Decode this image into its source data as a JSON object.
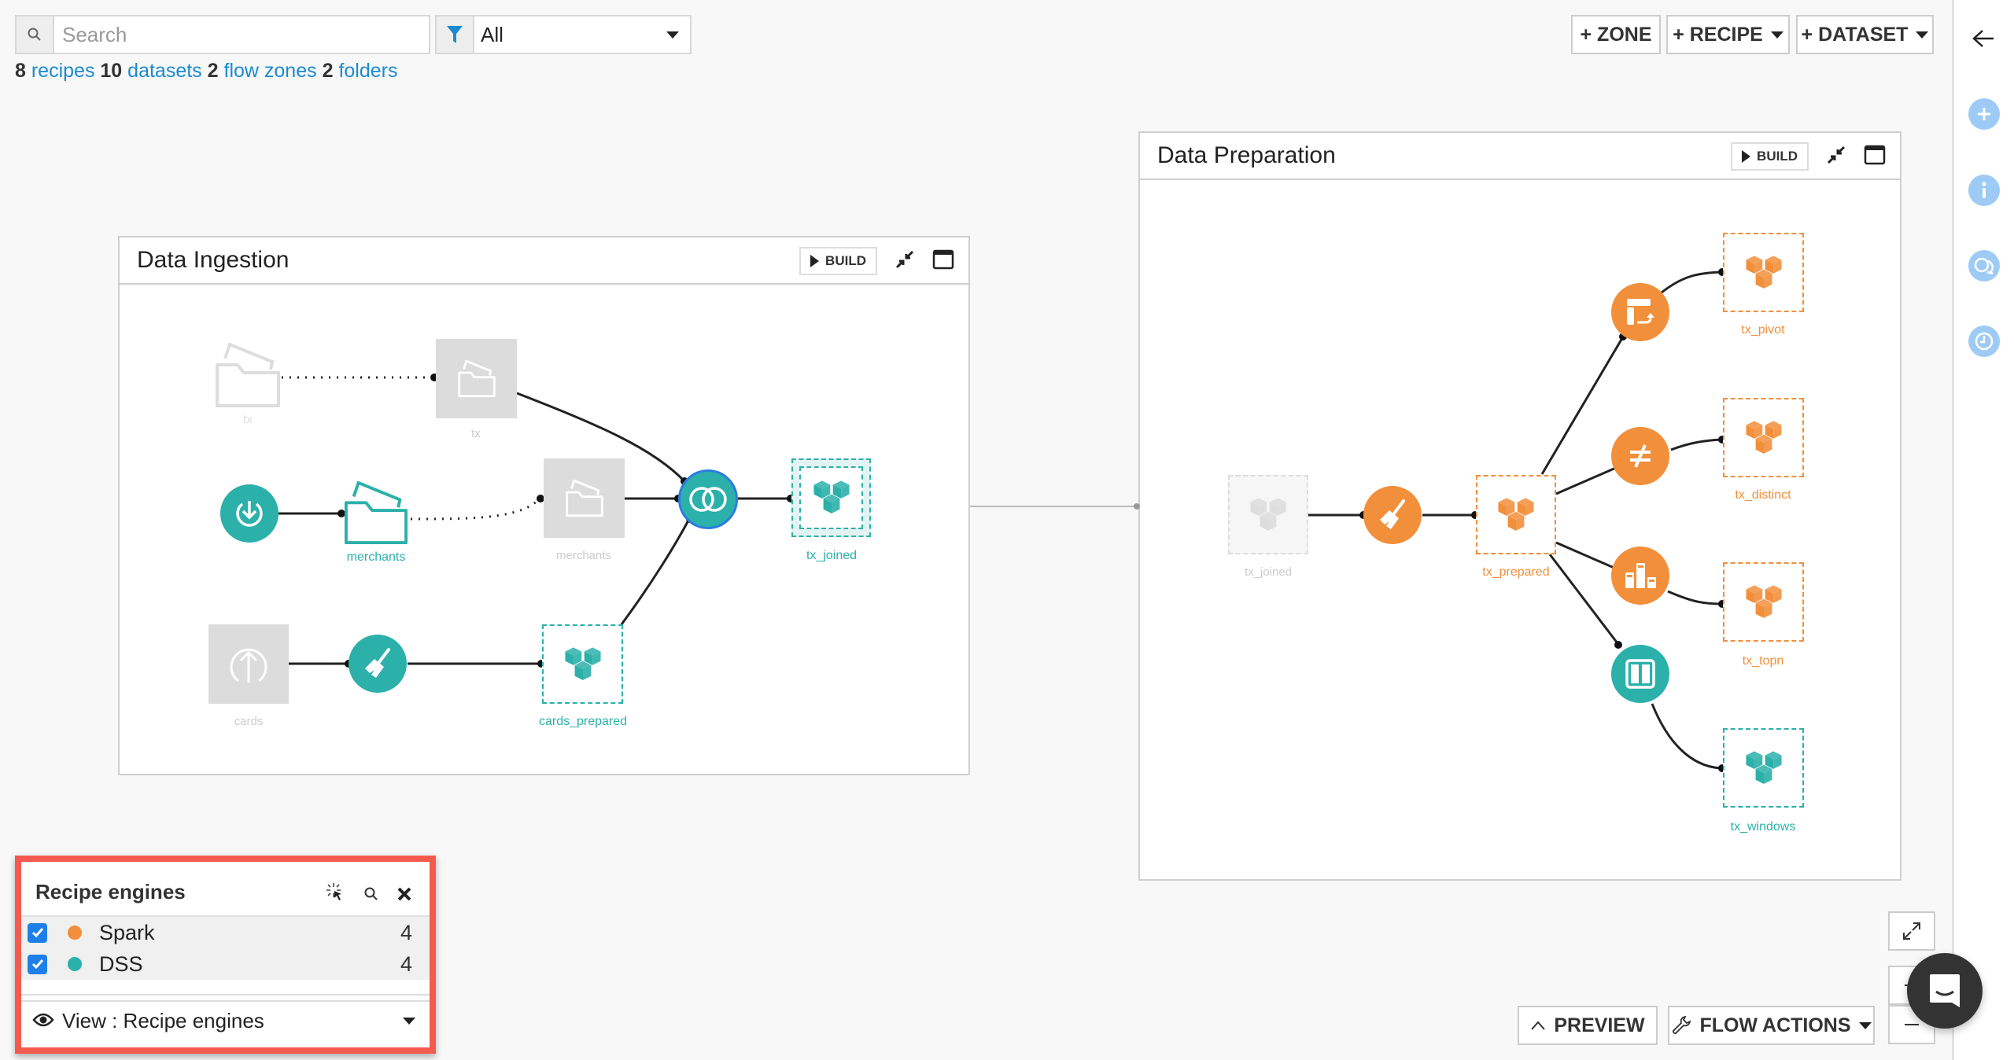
{
  "search": {
    "placeholder": "Search",
    "value": ""
  },
  "filter": {
    "selected": "All"
  },
  "stats": {
    "recipes_count": "8",
    "recipes_label": "recipes",
    "datasets_count": "10",
    "datasets_label": "datasets",
    "zones_count": "2",
    "zones_label": "flow zones",
    "folders_count": "2",
    "folders_label": "folders"
  },
  "toolbar": {
    "zone": "+ ZONE",
    "recipe": "+ RECIPE",
    "dataset": "+ DATASET"
  },
  "sidebar": {
    "icons": [
      "back-arrow-icon",
      "add-icon",
      "info-icon",
      "discussions-icon",
      "history-icon"
    ]
  },
  "colors": {
    "spark": "#f28f3b",
    "dss": "#2bb0aa",
    "faded": "#dcdcdc",
    "link": "#1a8bd1",
    "highlight": "#f55a4e"
  },
  "zones": [
    {
      "title": "Data Ingestion",
      "build_label": "BUILD",
      "nodes": [
        {
          "label": "tx",
          "type": "folder-source",
          "state": "faded"
        },
        {
          "label": "tx",
          "type": "managed-folder",
          "state": "faded"
        },
        {
          "label": "",
          "type": "download-recipe",
          "engine": "DSS"
        },
        {
          "label": "merchants",
          "type": "folder",
          "engine": "DSS"
        },
        {
          "label": "merchants",
          "type": "managed-folder",
          "state": "faded"
        },
        {
          "label": "",
          "type": "join-recipe",
          "engine": "DSS",
          "selected": true
        },
        {
          "label": "tx_joined",
          "type": "dataset",
          "engine": "DSS"
        },
        {
          "label": "cards",
          "type": "uploaded-dataset",
          "state": "faded"
        },
        {
          "label": "",
          "type": "prepare-recipe",
          "engine": "DSS"
        },
        {
          "label": "cards_prepared",
          "type": "dataset",
          "engine": "DSS"
        }
      ]
    },
    {
      "title": "Data Preparation",
      "build_label": "BUILD",
      "nodes": [
        {
          "label": "tx_joined",
          "type": "shared-dataset",
          "state": "faded"
        },
        {
          "label": "",
          "type": "prepare-recipe",
          "engine": "Spark"
        },
        {
          "label": "tx_prepared",
          "type": "dataset",
          "engine": "Spark"
        },
        {
          "label": "",
          "type": "pivot-recipe",
          "engine": "Spark"
        },
        {
          "label": "",
          "type": "distinct-recipe",
          "engine": "Spark"
        },
        {
          "label": "",
          "type": "topn-recipe",
          "engine": "Spark"
        },
        {
          "label": "",
          "type": "window-recipe",
          "engine": "DSS"
        },
        {
          "label": "tx_pivot",
          "type": "dataset",
          "engine": "Spark"
        },
        {
          "label": "tx_distinct",
          "type": "dataset",
          "engine": "Spark"
        },
        {
          "label": "tx_topn",
          "type": "dataset",
          "engine": "Spark"
        },
        {
          "label": "tx_windows",
          "type": "dataset",
          "engine": "DSS"
        }
      ]
    }
  ],
  "legend": {
    "title": "Recipe engines",
    "items": [
      {
        "name": "Spark",
        "count": "4",
        "checked": true
      },
      {
        "name": "DSS",
        "count": "4",
        "checked": true
      }
    ],
    "view_label": "View : Recipe engines"
  },
  "bottom": {
    "preview": "PREVIEW",
    "flow_actions": "FLOW ACTIONS"
  }
}
